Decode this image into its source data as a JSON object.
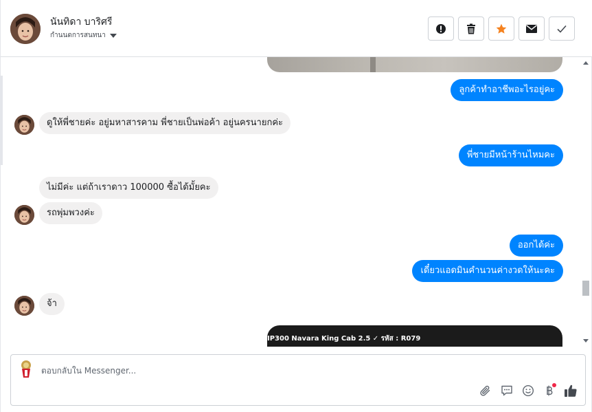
{
  "contact": {
    "name": "นันทิดา บาริศรี",
    "stage": "กำนนดการสนทนา"
  },
  "header_actions": [
    {
      "name": "spam-icon",
      "color": "#1c1e21"
    },
    {
      "name": "trash-icon",
      "color": "#1c1e21"
    },
    {
      "name": "star-icon",
      "color": "#f5821f"
    },
    {
      "name": "envelope-icon",
      "color": "#1c1e21"
    },
    {
      "name": "check-icon",
      "color": "#444950"
    }
  ],
  "messages": {
    "m1": "ลูกค้าทำอาชีพอะไรอยู่คะ",
    "m2": "ดูให้พี่ชายค่ะ อยู่มหาสารคาม พี่ชายเป็นพ่อค้า อยู่นครนายกค่ะ",
    "m3": "พี่ชายมีหน้าร้านไหมคะ",
    "m4": "ไม่มีค่ะ แต่ถ้าเราดาว 100000 ซื้อได้มั้ยคะ",
    "m5": "รถพุ่มพวงค่ะ",
    "m6": "ออกได้ค่ะ",
    "m7": "เดี๋ยวแอดมินคำนวนค่างวดให้นะคะ",
    "m8": "จ้า",
    "image_caption": "IP300 Navara King Cab 2.5 ✓ รหัส : R079"
  },
  "composer": {
    "placeholder": "ตอบกลับใน Messenger..."
  },
  "tools": [
    "paperclip-icon",
    "saved-reply-icon",
    "emoji-icon",
    "baht-icon",
    "thumbs-up-icon"
  ],
  "colors": {
    "accent": "#0084ff",
    "incoming_bg": "#f1f0f0",
    "notification": "#f02849"
  }
}
